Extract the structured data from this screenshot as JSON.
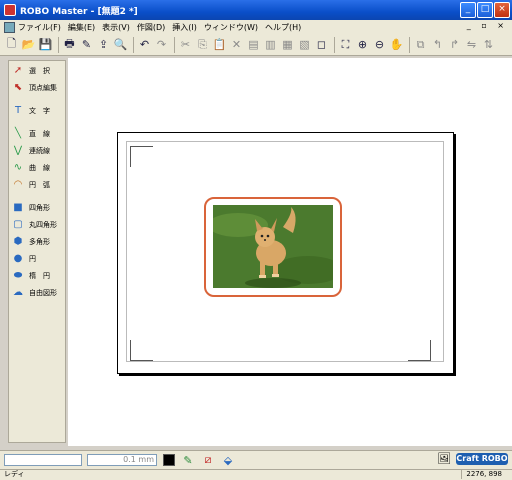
{
  "window": {
    "title": "ROBO Master - [無題2 *]",
    "buttons": [
      "_",
      "□",
      "×"
    ]
  },
  "menu": {
    "items": [
      "ファイル(F)",
      "編集(E)",
      "表示(V)",
      "作図(D)",
      "挿入(I)",
      "ウィンドウ(W)",
      "ヘルプ(H)"
    ],
    "mdi_controls": "_ ▫ ×"
  },
  "toolbar": {
    "icons": [
      "new-icon",
      "open-icon",
      "save-icon",
      "print-icon",
      "cut-settings-icon",
      "send-icon",
      "preview-icon",
      "undo-icon",
      "redo-icon",
      "knife-icon",
      "copy-icon",
      "paste-icon",
      "delete-icon",
      "group-icon",
      "ungroup-icon",
      "align-icon",
      "weld-icon",
      "frame-icon",
      "zoom-fit-icon",
      "zoom-in-icon",
      "zoom-out-icon",
      "pan-icon",
      "transform-icon",
      "rotate-left-icon",
      "rotate-right-icon",
      "mirror-icon",
      "flip-icon"
    ]
  },
  "tools": [
    {
      "label": "選　択",
      "icon": "arrow-icon",
      "color": "#c0302a"
    },
    {
      "label": "頂点編集",
      "icon": "node-edit-icon",
      "color": "#c0302a"
    },
    {
      "label": "文　字",
      "icon": "text-icon",
      "color": "#2a6ac0"
    },
    {
      "label": "直　線",
      "icon": "line-icon",
      "color": "#2a9a4a"
    },
    {
      "label": "連続線",
      "icon": "polyline-icon",
      "color": "#2a9a4a"
    },
    {
      "label": "曲　線",
      "icon": "curve-icon",
      "color": "#2a9a4a"
    },
    {
      "label": "円　弧",
      "icon": "arc-icon",
      "color": "#c07020"
    },
    {
      "label": "四角形",
      "icon": "rectangle-icon",
      "color": "#2a6ac0"
    },
    {
      "label": "丸四角形",
      "icon": "rounded-rect-icon",
      "color": "#2a6ac0"
    },
    {
      "label": "多角形",
      "icon": "polygon-icon",
      "color": "#2a6ac0"
    },
    {
      "label": "円",
      "icon": "circle-icon",
      "color": "#2a6ac0"
    },
    {
      "label": "楕　円",
      "icon": "ellipse-icon",
      "color": "#2a6ac0"
    },
    {
      "label": "自由図形",
      "icon": "freeform-icon",
      "color": "#2a6ac0"
    }
  ],
  "bottom": {
    "stroke_width": "0.1 mm",
    "logo": "Craft ROBO"
  },
  "status": {
    "text": "レディ",
    "coords": "2276, 898"
  },
  "colors": {
    "title_bar": "#0a4fc9",
    "photo_frame": "#d9643a",
    "logo": "#1e5fb0"
  }
}
